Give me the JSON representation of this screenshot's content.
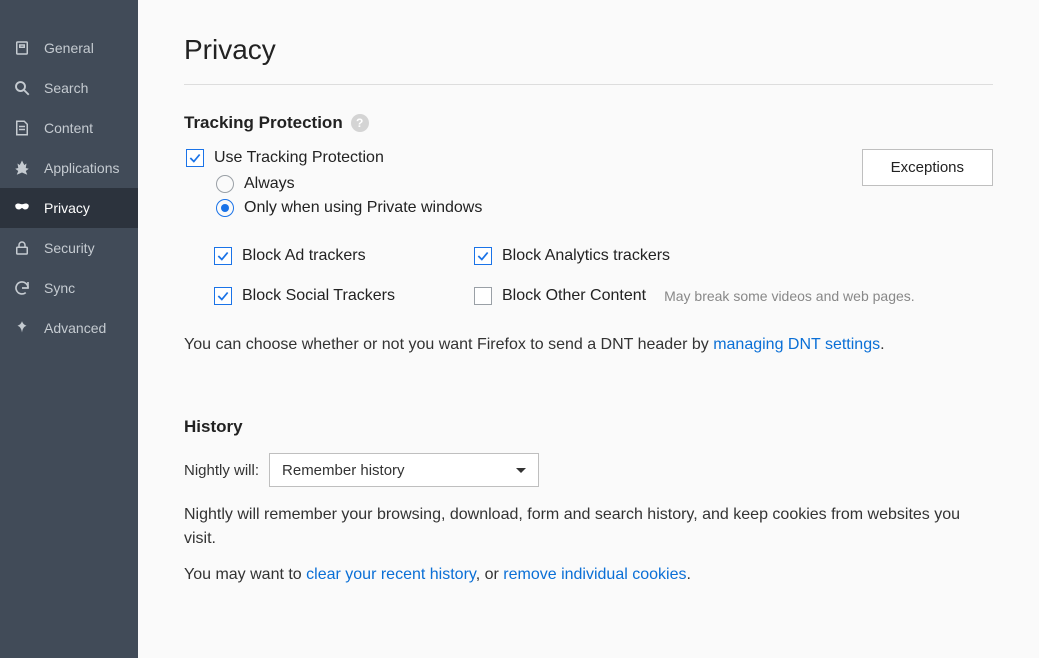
{
  "sidebar": {
    "items": [
      {
        "label": "General"
      },
      {
        "label": "Search"
      },
      {
        "label": "Content"
      },
      {
        "label": "Applications"
      },
      {
        "label": "Privacy"
      },
      {
        "label": "Security"
      },
      {
        "label": "Sync"
      },
      {
        "label": "Advanced"
      }
    ]
  },
  "page": {
    "title": "Privacy"
  },
  "tracking": {
    "heading": "Tracking Protection",
    "enable_label": "Use Tracking Protection",
    "radio_always": "Always",
    "radio_private": "Only when using Private windows",
    "exceptions_btn": "Exceptions",
    "block_ad": "Block Ad trackers",
    "block_analytics": "Block Analytics trackers",
    "block_social": "Block Social Trackers",
    "block_other": "Block Other Content",
    "block_other_hint": "May break some videos and web pages.",
    "dnt_pre": "You can choose whether or not you want Firefox to send a DNT header by ",
    "dnt_link": "managing DNT settings",
    "dnt_post": "."
  },
  "history": {
    "heading": "History",
    "prefix": "Nightly will:",
    "select_value": "Remember history",
    "desc": "Nightly will remember your browsing, download, form and search history, and keep cookies from websites you visit.",
    "suffix_pre": "You may want to ",
    "clear_link": "clear your recent history",
    "mid": ", or ",
    "cookies_link": "remove individual cookies",
    "post": "."
  }
}
